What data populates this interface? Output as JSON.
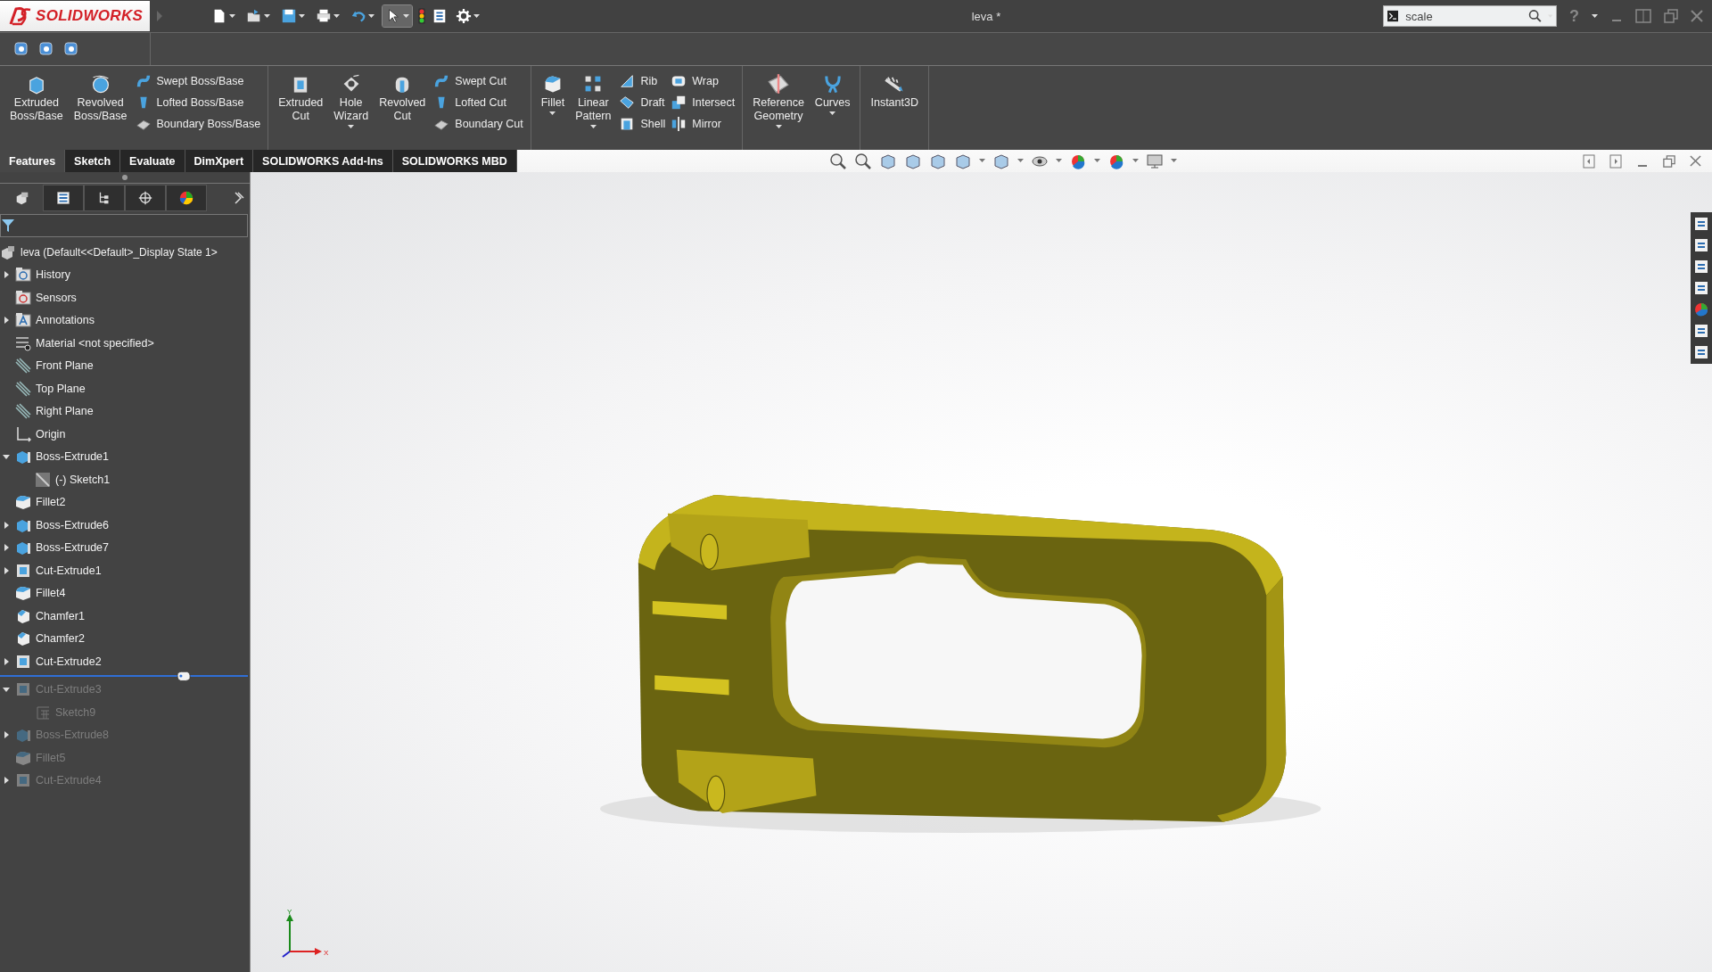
{
  "window": {
    "logo": "SOLIDWORKS",
    "title": "leva *",
    "help": "?"
  },
  "search": {
    "value": "scale"
  },
  "ribbon": {
    "groups": [
      {
        "items": [
          {
            "kind": "large",
            "label": "Extruded Boss/Base",
            "dropdown": false
          },
          {
            "kind": "large",
            "label": "Revolved Boss/Base",
            "dropdown": false
          },
          {
            "kind": "stack",
            "items": [
              {
                "label": "Swept Boss/Base"
              },
              {
                "label": "Lofted Boss/Base"
              },
              {
                "label": "Boundary Boss/Base"
              }
            ]
          }
        ]
      },
      {
        "items": [
          {
            "kind": "large",
            "label": "Extruded Cut",
            "dropdown": false
          },
          {
            "kind": "large",
            "label": "Hole Wizard",
            "dropdown": true
          },
          {
            "kind": "large",
            "label": "Revolved Cut",
            "dropdown": false
          },
          {
            "kind": "stack",
            "items": [
              {
                "label": "Swept Cut"
              },
              {
                "label": "Lofted Cut"
              },
              {
                "label": "Boundary Cut"
              }
            ]
          }
        ]
      },
      {
        "items": [
          {
            "kind": "large",
            "label": "Fillet",
            "dropdown": true
          },
          {
            "kind": "large",
            "label": "Linear Pattern",
            "dropdown": true
          },
          {
            "kind": "stack",
            "items": [
              {
                "label": "Rib"
              },
              {
                "label": "Draft"
              },
              {
                "label": "Shell"
              }
            ]
          },
          {
            "kind": "stack",
            "items": [
              {
                "label": "Wrap"
              },
              {
                "label": "Intersect"
              },
              {
                "label": "Mirror"
              }
            ]
          }
        ]
      },
      {
        "items": [
          {
            "kind": "large",
            "label": "Reference Geometry",
            "dropdown": true
          },
          {
            "kind": "large",
            "label": "Curves",
            "dropdown": true
          }
        ]
      },
      {
        "items": [
          {
            "kind": "large",
            "label": "Instant3D",
            "dropdown": false
          }
        ]
      }
    ]
  },
  "tabs": [
    {
      "label": "Features",
      "selected": true
    },
    {
      "label": "Sketch",
      "selected": false
    },
    {
      "label": "Evaluate",
      "selected": false
    },
    {
      "label": "DimXpert",
      "selected": false
    },
    {
      "label": "SOLIDWORKS Add-Ins",
      "selected": false
    },
    {
      "label": "SOLIDWORKS MBD",
      "selected": false
    }
  ],
  "feature_manager": {
    "panel_tabs": [
      {
        "kind": "feature-tree",
        "selected": true
      },
      {
        "kind": "property",
        "selected": false
      },
      {
        "kind": "configuration",
        "selected": false
      },
      {
        "kind": "dimxpert",
        "selected": false
      },
      {
        "kind": "display",
        "selected": false
      }
    ],
    "root": "leva  (Default<<Default>_Display State 1>",
    "items": [
      {
        "label": "History",
        "kind": "history",
        "expanded": false,
        "rolled_back": false
      },
      {
        "label": "Sensors",
        "kind": "sensors",
        "rolled_back": false
      },
      {
        "label": "Annotations",
        "kind": "annotations",
        "expanded": false,
        "rolled_back": false
      },
      {
        "label": "Material <not specified>",
        "kind": "material",
        "rolled_back": false
      },
      {
        "label": "Front Plane",
        "kind": "plane",
        "rolled_back": false
      },
      {
        "label": "Top Plane",
        "kind": "plane",
        "rolled_back": false
      },
      {
        "label": "Right Plane",
        "kind": "plane",
        "rolled_back": false
      },
      {
        "label": "Origin",
        "kind": "origin",
        "rolled_back": false
      },
      {
        "label": "Boss-Extrude1",
        "kind": "extrude",
        "expanded": true,
        "rolled_back": false,
        "children": [
          {
            "label": "(-) Sketch1",
            "kind": "sketch",
            "rolled_back": false
          }
        ]
      },
      {
        "label": "Fillet2",
        "kind": "fillet",
        "rolled_back": false
      },
      {
        "label": "Boss-Extrude6",
        "kind": "extrude",
        "expanded": false,
        "rolled_back": false
      },
      {
        "label": "Boss-Extrude7",
        "kind": "extrude",
        "expanded": false,
        "rolled_back": false
      },
      {
        "label": "Cut-Extrude1",
        "kind": "cut",
        "expanded": false,
        "rolled_back": false
      },
      {
        "label": "Fillet4",
        "kind": "fillet",
        "rolled_back": false
      },
      {
        "label": "Chamfer1",
        "kind": "chamfer",
        "rolled_back": false
      },
      {
        "label": "Chamfer2",
        "kind": "chamfer",
        "rolled_back": false
      },
      {
        "label": "Cut-Extrude2",
        "kind": "cut",
        "expanded": false,
        "rolled_back": false
      },
      {
        "label": "Cut-Extrude3",
        "kind": "cut",
        "expanded": true,
        "rolled_back": true,
        "children": [
          {
            "label": "Sketch9",
            "kind": "sketch-grid",
            "rolled_back": true
          }
        ]
      },
      {
        "label": "Boss-Extrude8",
        "kind": "extrude",
        "expanded": false,
        "rolled_back": true
      },
      {
        "label": "Fillet5",
        "kind": "fillet",
        "rolled_back": true
      },
      {
        "label": "Cut-Extrude4",
        "kind": "cut",
        "expanded": false,
        "rolled_back": true
      }
    ]
  },
  "triad": {
    "y_label": "Y",
    "x_label": "X"
  }
}
